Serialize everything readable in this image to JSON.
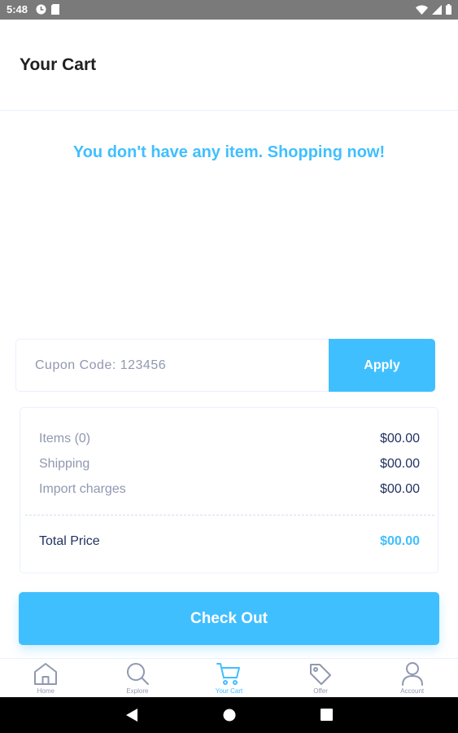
{
  "status_bar": {
    "time": "5:48",
    "left_icons": [
      "notification-icon",
      "sd-card-icon"
    ],
    "right_icons": [
      "wifi-icon",
      "signal-icon",
      "battery-icon"
    ]
  },
  "header": {
    "title": "Your Cart"
  },
  "empty_state": {
    "message": "You don't have any item. Shopping now!"
  },
  "coupon": {
    "placeholder": "Cupon Code: 123456",
    "value": "",
    "apply_label": "Apply"
  },
  "summary": {
    "rows": [
      {
        "label": "Items (0)",
        "value": "$00.00"
      },
      {
        "label": "Shipping",
        "value": "$00.00"
      },
      {
        "label": "Import charges",
        "value": "$00.00"
      }
    ],
    "total": {
      "label": "Total Price",
      "value": "$00.00"
    }
  },
  "checkout": {
    "label": "Check Out"
  },
  "bottom_nav": {
    "active": "Your Cart",
    "items": [
      {
        "label": "Home",
        "icon": "home-icon"
      },
      {
        "label": "Explore",
        "icon": "search-icon"
      },
      {
        "label": "Your Cart",
        "icon": "cart-icon"
      },
      {
        "label": "Offer",
        "icon": "tag-icon"
      },
      {
        "label": "Account",
        "icon": "user-icon"
      }
    ]
  },
  "system_nav": [
    "back-icon",
    "home-circle-icon",
    "recents-icon"
  ],
  "colors": {
    "accent": "#40bfff",
    "text_dark": "#223263",
    "text_muted": "#9098b1",
    "border": "#ebf0ff"
  }
}
